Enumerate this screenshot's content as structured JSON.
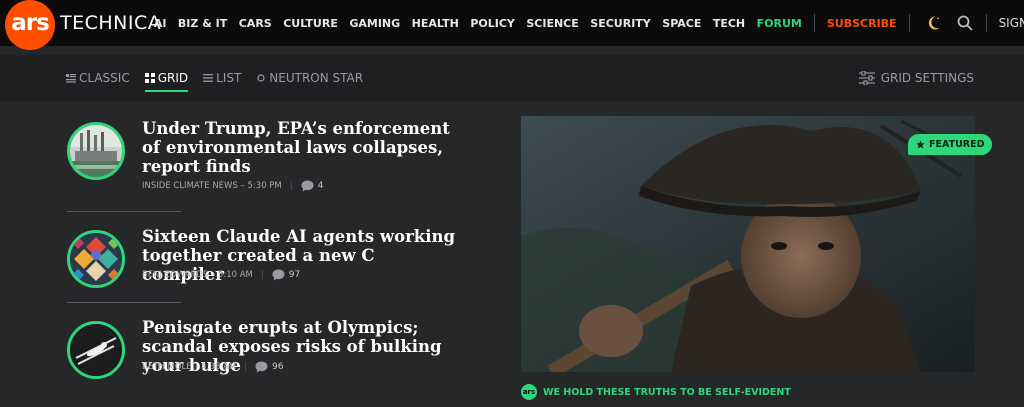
{
  "brand": {
    "logo_mark": "ars",
    "logo_word": "TECHNICA"
  },
  "nav": {
    "items": [
      "AI",
      "BIZ & IT",
      "CARS",
      "CULTURE",
      "GAMING",
      "HEALTH",
      "POLICY",
      "SCIENCE",
      "SECURITY",
      "SPACE",
      "TECH"
    ],
    "forum": "FORUM",
    "subscribe": "SUBSCRIBE",
    "sign": "SIGN"
  },
  "view": {
    "options": [
      {
        "label": "CLASSIC",
        "icon": "classic-layout-icon",
        "active": false
      },
      {
        "label": "GRID",
        "icon": "grid-layout-icon",
        "active": true
      },
      {
        "label": "LIST",
        "icon": "list-layout-icon",
        "active": false
      },
      {
        "label": "NEUTRON STAR",
        "icon": "neutron-star-icon",
        "active": false
      }
    ],
    "settings_label": "GRID SETTINGS"
  },
  "articles": [
    {
      "title": "Under Trump, EPA’s enforcement of environmental laws collapses, report finds",
      "source": "INSIDE CLIMATE NEWS",
      "time": "5:30 PM",
      "comments": "4"
    },
    {
      "title": "Sixteen Claude AI agents working together created a new C compiler",
      "source": "BENJ EDWARDS",
      "time": "5:10 AM",
      "comments": "97"
    },
    {
      "title": "Penisgate erupts at Olympics; scandal exposes risks of bulking your bulge",
      "source": "BETH MOLE",
      "time": "4:38 AM",
      "comments": "96"
    }
  ],
  "featured": {
    "badge": "FEATURED",
    "caption": "WE HOLD THESE TRUTHS TO BE SELF-EVIDENT",
    "caption_logo": "ars"
  },
  "colors": {
    "accent_green": "#2ed67c",
    "brand_orange": "#ff4e00",
    "background": "#262729",
    "topbar": "#0b0b0c"
  }
}
